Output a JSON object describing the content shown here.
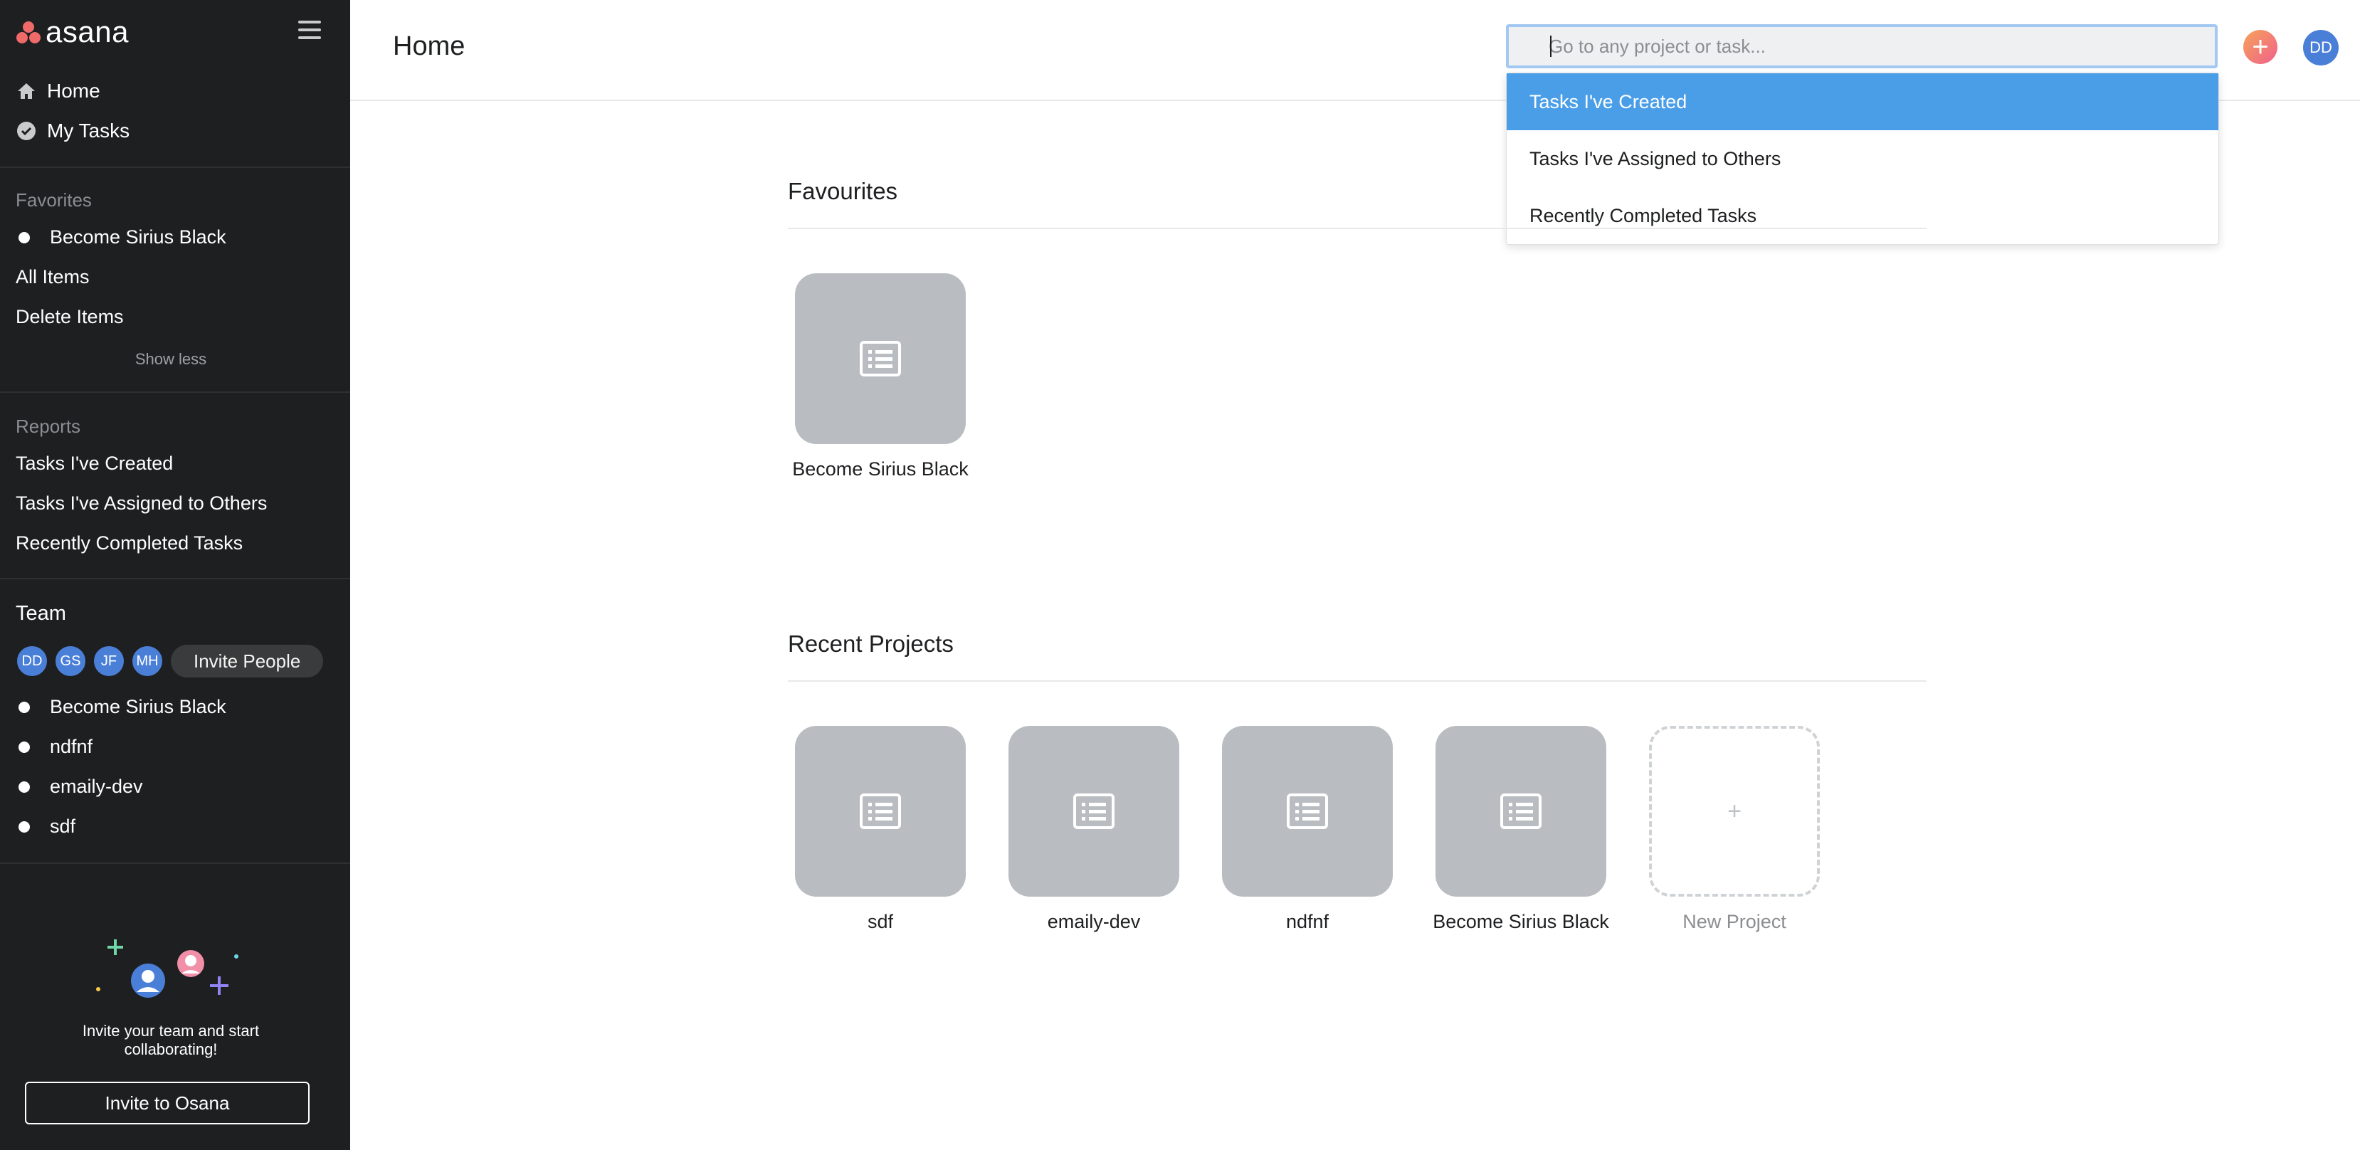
{
  "sidebar": {
    "logo_text": "asana",
    "nav": [
      {
        "label": "Home",
        "icon": "home-icon"
      },
      {
        "label": "My Tasks",
        "icon": "check-circle-icon"
      }
    ],
    "favorites_label": "Favorites",
    "favorites": [
      "Become Sirius Black"
    ],
    "all_items": "All Items",
    "delete_items": "Delete Items",
    "show_less": "Show less",
    "reports_label": "Reports",
    "reports": [
      "Tasks I've Created",
      "Tasks I've Assigned to Others",
      "Recently Completed Tasks"
    ],
    "team_label": "Team",
    "team_members": [
      "DD",
      "GS",
      "JF",
      "MH"
    ],
    "invite_people": "Invite People",
    "projects": [
      "Become Sirius Black",
      "ndfnf",
      "emaily-dev",
      "sdf"
    ],
    "invite_text": "Invite your team and start collaborating!",
    "invite_button": "Invite to Osana"
  },
  "topbar": {
    "title": "Home",
    "search_placeholder": "Go to any project or task...",
    "user_initials": "DD"
  },
  "dropdown": {
    "items": [
      "Tasks I've Created",
      "Tasks I've Assigned to Others",
      "Recently Completed Tasks"
    ],
    "active_index": 0
  },
  "main": {
    "favourites_title": "Favourites",
    "favourites": [
      "Become Sirius Black"
    ],
    "recent_title": "Recent Projects",
    "recent": [
      "sdf",
      "emaily-dev",
      "ndfnf",
      "Become Sirius Black"
    ],
    "new_project": "New Project"
  },
  "colors": {
    "sidebar_bg": "#1e1f21",
    "accent_blue": "#4a9ee8",
    "tile_gray": "#b9bdc1",
    "avatar_blue": "#4a7fd8",
    "logo_coral": "#f06a6a"
  }
}
